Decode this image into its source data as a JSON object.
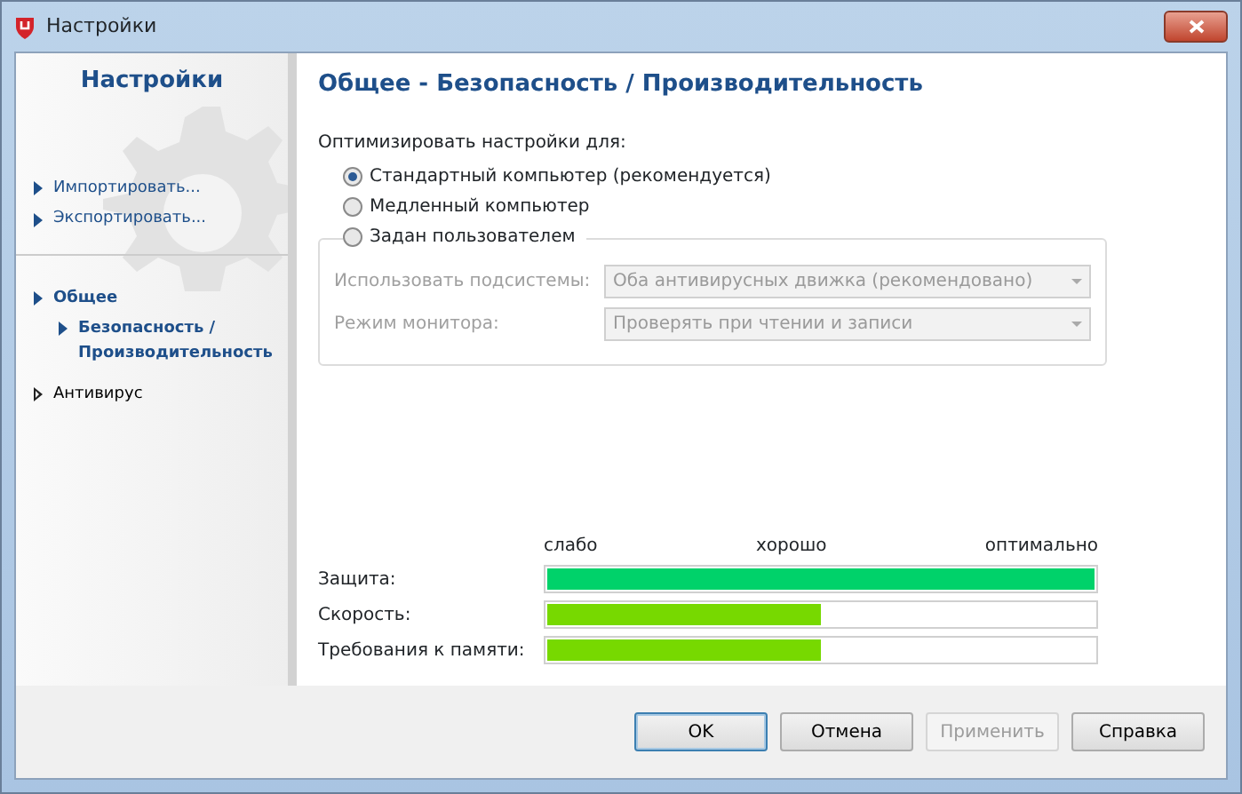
{
  "window": {
    "title": "Настройки"
  },
  "sidebar": {
    "title": "Настройки",
    "actions": [
      {
        "label": "Импортировать..."
      },
      {
        "label": "Экспортировать..."
      }
    ],
    "tree": [
      {
        "label": "Общее",
        "expanded": true,
        "children": [
          {
            "label": "Безопасность / Производительность",
            "selected": true
          }
        ]
      },
      {
        "label": "Антивирус",
        "expanded": false
      }
    ]
  },
  "page": {
    "title": "Общее - Безопасность / Производительность",
    "optimize_label": "Оптимизировать настройки для:",
    "options": [
      {
        "label": "Стандартный компьютер (рекомендуется)",
        "selected": true
      },
      {
        "label": "Медленный компьютер",
        "selected": false
      },
      {
        "label": "Задан пользователем",
        "selected": false
      }
    ],
    "custom_fields": [
      {
        "label": "Использовать подсистемы:",
        "value": "Оба антивирусных движка (рекомендовано)",
        "disabled": true
      },
      {
        "label": "Режим монитора:",
        "value": "Проверять при чтении и записи",
        "disabled": true
      }
    ],
    "scale": [
      "слабо",
      "хорошо",
      "оптимально"
    ],
    "meters": [
      {
        "label": "Защита:",
        "level": 1.0,
        "color": "#00d26a"
      },
      {
        "label": "Скорость:",
        "level": 0.5,
        "color": "#77d900"
      },
      {
        "label": "Требования к памяти:",
        "level": 0.5,
        "color": "#77d900"
      }
    ]
  },
  "buttons": [
    {
      "label": "OK",
      "default": true,
      "disabled": false
    },
    {
      "label": "Отмена",
      "default": false,
      "disabled": false
    },
    {
      "label": "Применить",
      "default": false,
      "disabled": true
    },
    {
      "label": "Справка",
      "default": false,
      "disabled": false
    }
  ]
}
